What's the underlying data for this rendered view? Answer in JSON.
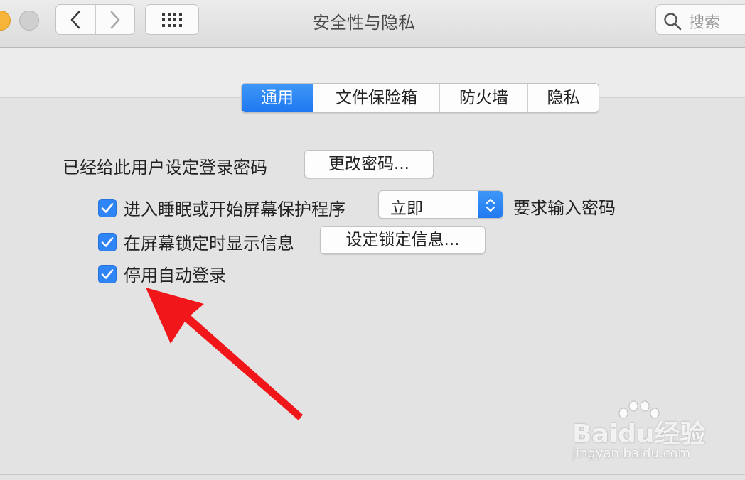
{
  "window": {
    "title": "安全性与隐私"
  },
  "toolbar": {
    "search_placeholder": "搜索"
  },
  "tabs": [
    {
      "label": "通用",
      "active": true
    },
    {
      "label": "文件保险箱",
      "active": false
    },
    {
      "label": "防火墙",
      "active": false
    },
    {
      "label": "隐私",
      "active": false
    }
  ],
  "general": {
    "password_label": "已经给此用户设定登录密码",
    "change_password_button": "更改密码...",
    "require_password": {
      "checked": true,
      "label": "进入睡眠或开始屏幕保护程序",
      "select_value": "立即",
      "suffix": "要求输入密码"
    },
    "show_message": {
      "checked": true,
      "label": "在屏幕锁定时显示信息",
      "button": "设定锁定信息..."
    },
    "disable_autologin": {
      "checked": true,
      "label": "停用自动登录"
    }
  },
  "watermark": {
    "logo": "Baidu经验",
    "url": "jingyan.baidu.com"
  },
  "colors": {
    "accent": "#2f85f5",
    "annotation_arrow": "#f0161a"
  }
}
